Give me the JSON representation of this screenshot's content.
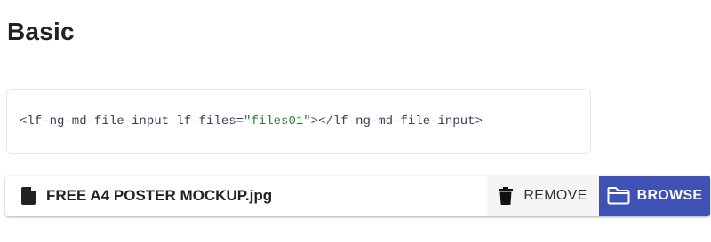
{
  "section": {
    "title": "Basic"
  },
  "code": {
    "part1": "<lf-ng-md-file-input lf-files=",
    "string": "\"files01\"",
    "part2": " ></lf-ng-md-file-input>"
  },
  "file_input": {
    "file_name": "FREE A4 POSTER MOCKUP.jpg",
    "remove_label": "REMOVE",
    "browse_label": "BROWSE",
    "file_icon": "file-icon",
    "remove_icon": "trash-icon",
    "browse_icon": "folder-icon",
    "accent_color": "#3f51b5"
  }
}
